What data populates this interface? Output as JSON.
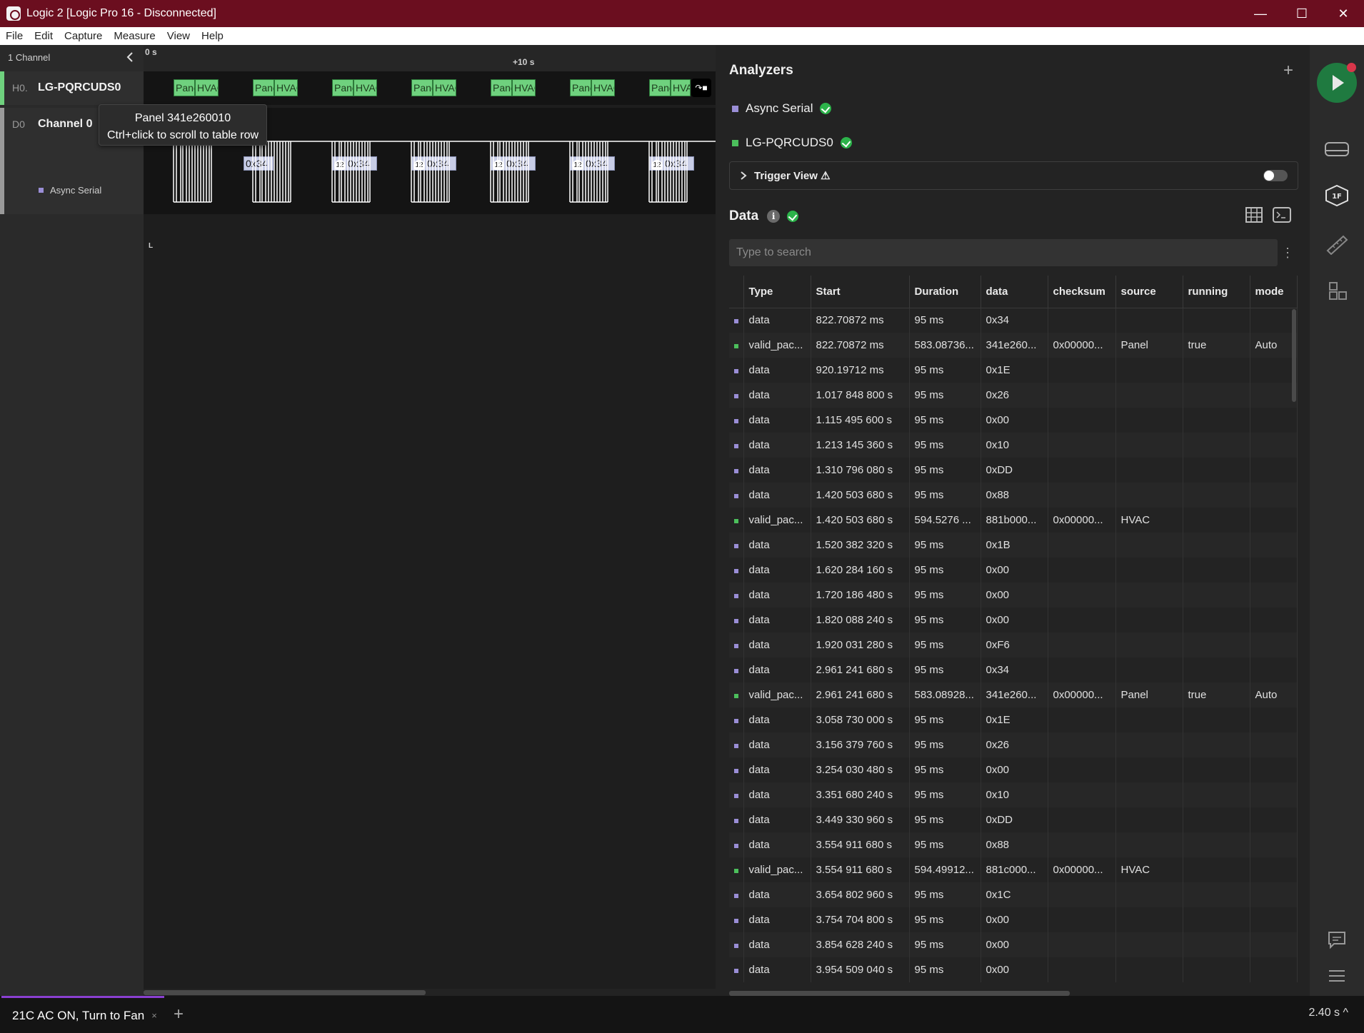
{
  "window": {
    "title": "Logic 2 [Logic Pro 16 - Disconnected]",
    "minimize": "—",
    "maximize": "☐",
    "close": "✕"
  },
  "menu": [
    "File",
    "Edit",
    "Capture",
    "Measure",
    "View",
    "Help"
  ],
  "sidebar": {
    "header": "1 Channel",
    "channels": [
      {
        "index": "H0.",
        "name": "LG-PQRCUDS0",
        "color": "#6fd17e"
      },
      {
        "index": "D0",
        "name": "Channel 0",
        "color": "#b0b0b0"
      }
    ],
    "sub_analyzer": "Async Serial"
  },
  "timeline": {
    "start": "0 s",
    "mid": "+10 s",
    "low_marker": "L"
  },
  "waveform": {
    "packet_a": "Panel",
    "packet_b": "HVAC",
    "byte_badge": "12",
    "byte_value": "0x34"
  },
  "tooltip": {
    "line1": "Panel 341e260010",
    "line2": "Ctrl+click to scroll to table row"
  },
  "analyzers": {
    "title": "Analyzers",
    "items": [
      {
        "name": "Async Serial",
        "color": "#9a8ed6"
      },
      {
        "name": "LG-PQRCUDS0",
        "color": "#4cbf5c"
      }
    ],
    "trigger_view": "Trigger View ⚠"
  },
  "data": {
    "title": "Data",
    "info": "i",
    "search_placeholder": "Type to search",
    "columns": [
      "",
      "Type",
      "Start",
      "Duration",
      "data",
      "checksum",
      "source",
      "running",
      "mode"
    ],
    "rows": [
      [
        "data",
        "822.70872 ms",
        "95 ms",
        "0x34",
        "",
        "",
        "",
        ""
      ],
      [
        "valid_pac...",
        "822.70872 ms",
        "583.08736...",
        "341e260...",
        "0x00000...",
        "Panel",
        "true",
        "Auto"
      ],
      [
        "data",
        "920.19712 ms",
        "95 ms",
        "0x1E",
        "",
        "",
        "",
        ""
      ],
      [
        "data",
        "1.017 848 800 s",
        "95 ms",
        "0x26",
        "",
        "",
        "",
        ""
      ],
      [
        "data",
        "1.115 495 600 s",
        "95 ms",
        "0x00",
        "",
        "",
        "",
        ""
      ],
      [
        "data",
        "1.213 145 360 s",
        "95 ms",
        "0x10",
        "",
        "",
        "",
        ""
      ],
      [
        "data",
        "1.310 796 080 s",
        "95 ms",
        "0xDD",
        "",
        "",
        "",
        ""
      ],
      [
        "data",
        "1.420 503 680 s",
        "95 ms",
        "0x88",
        "",
        "",
        "",
        ""
      ],
      [
        "valid_pac...",
        "1.420 503 680 s",
        "594.5276 ...",
        "881b000...",
        "0x00000...",
        "HVAC",
        "",
        ""
      ],
      [
        "data",
        "1.520 382 320 s",
        "95 ms",
        "0x1B",
        "",
        "",
        "",
        ""
      ],
      [
        "data",
        "1.620 284 160 s",
        "95 ms",
        "0x00",
        "",
        "",
        "",
        ""
      ],
      [
        "data",
        "1.720 186 480 s",
        "95 ms",
        "0x00",
        "",
        "",
        "",
        ""
      ],
      [
        "data",
        "1.820 088 240 s",
        "95 ms",
        "0x00",
        "",
        "",
        "",
        ""
      ],
      [
        "data",
        "1.920 031 280 s",
        "95 ms",
        "0xF6",
        "",
        "",
        "",
        ""
      ],
      [
        "data",
        "2.961 241 680 s",
        "95 ms",
        "0x34",
        "",
        "",
        "",
        ""
      ],
      [
        "valid_pac...",
        "2.961 241 680 s",
        "583.08928...",
        "341e260...",
        "0x00000...",
        "Panel",
        "true",
        "Auto"
      ],
      [
        "data",
        "3.058 730 000 s",
        "95 ms",
        "0x1E",
        "",
        "",
        "",
        ""
      ],
      [
        "data",
        "3.156 379 760 s",
        "95 ms",
        "0x26",
        "",
        "",
        "",
        ""
      ],
      [
        "data",
        "3.254 030 480 s",
        "95 ms",
        "0x00",
        "",
        "",
        "",
        ""
      ],
      [
        "data",
        "3.351 680 240 s",
        "95 ms",
        "0x10",
        "",
        "",
        "",
        ""
      ],
      [
        "data",
        "3.449 330 960 s",
        "95 ms",
        "0xDD",
        "",
        "",
        "",
        ""
      ],
      [
        "data",
        "3.554 911 680 s",
        "95 ms",
        "0x88",
        "",
        "",
        "",
        ""
      ],
      [
        "valid_pac...",
        "3.554 911 680 s",
        "594.49912...",
        "881c000...",
        "0x00000...",
        "HVAC",
        "",
        ""
      ],
      [
        "data",
        "3.654 802 960 s",
        "95 ms",
        "0x1C",
        "",
        "",
        "",
        ""
      ],
      [
        "data",
        "3.754 704 800 s",
        "95 ms",
        "0x00",
        "",
        "",
        "",
        ""
      ],
      [
        "data",
        "3.854 628 240 s",
        "95 ms",
        "0x00",
        "",
        "",
        "",
        ""
      ],
      [
        "data",
        "3.954 509 040 s",
        "95 ms",
        "0x00",
        "",
        "",
        "",
        ""
      ]
    ],
    "colors": {
      "data": "#9a8ed6",
      "valid": "#4cbf5c"
    }
  },
  "bottom": {
    "tab_label": "21C AC ON, Turn to Fan",
    "tab_close": "×",
    "add_tab": "+",
    "duration": "2.40 s ^"
  }
}
